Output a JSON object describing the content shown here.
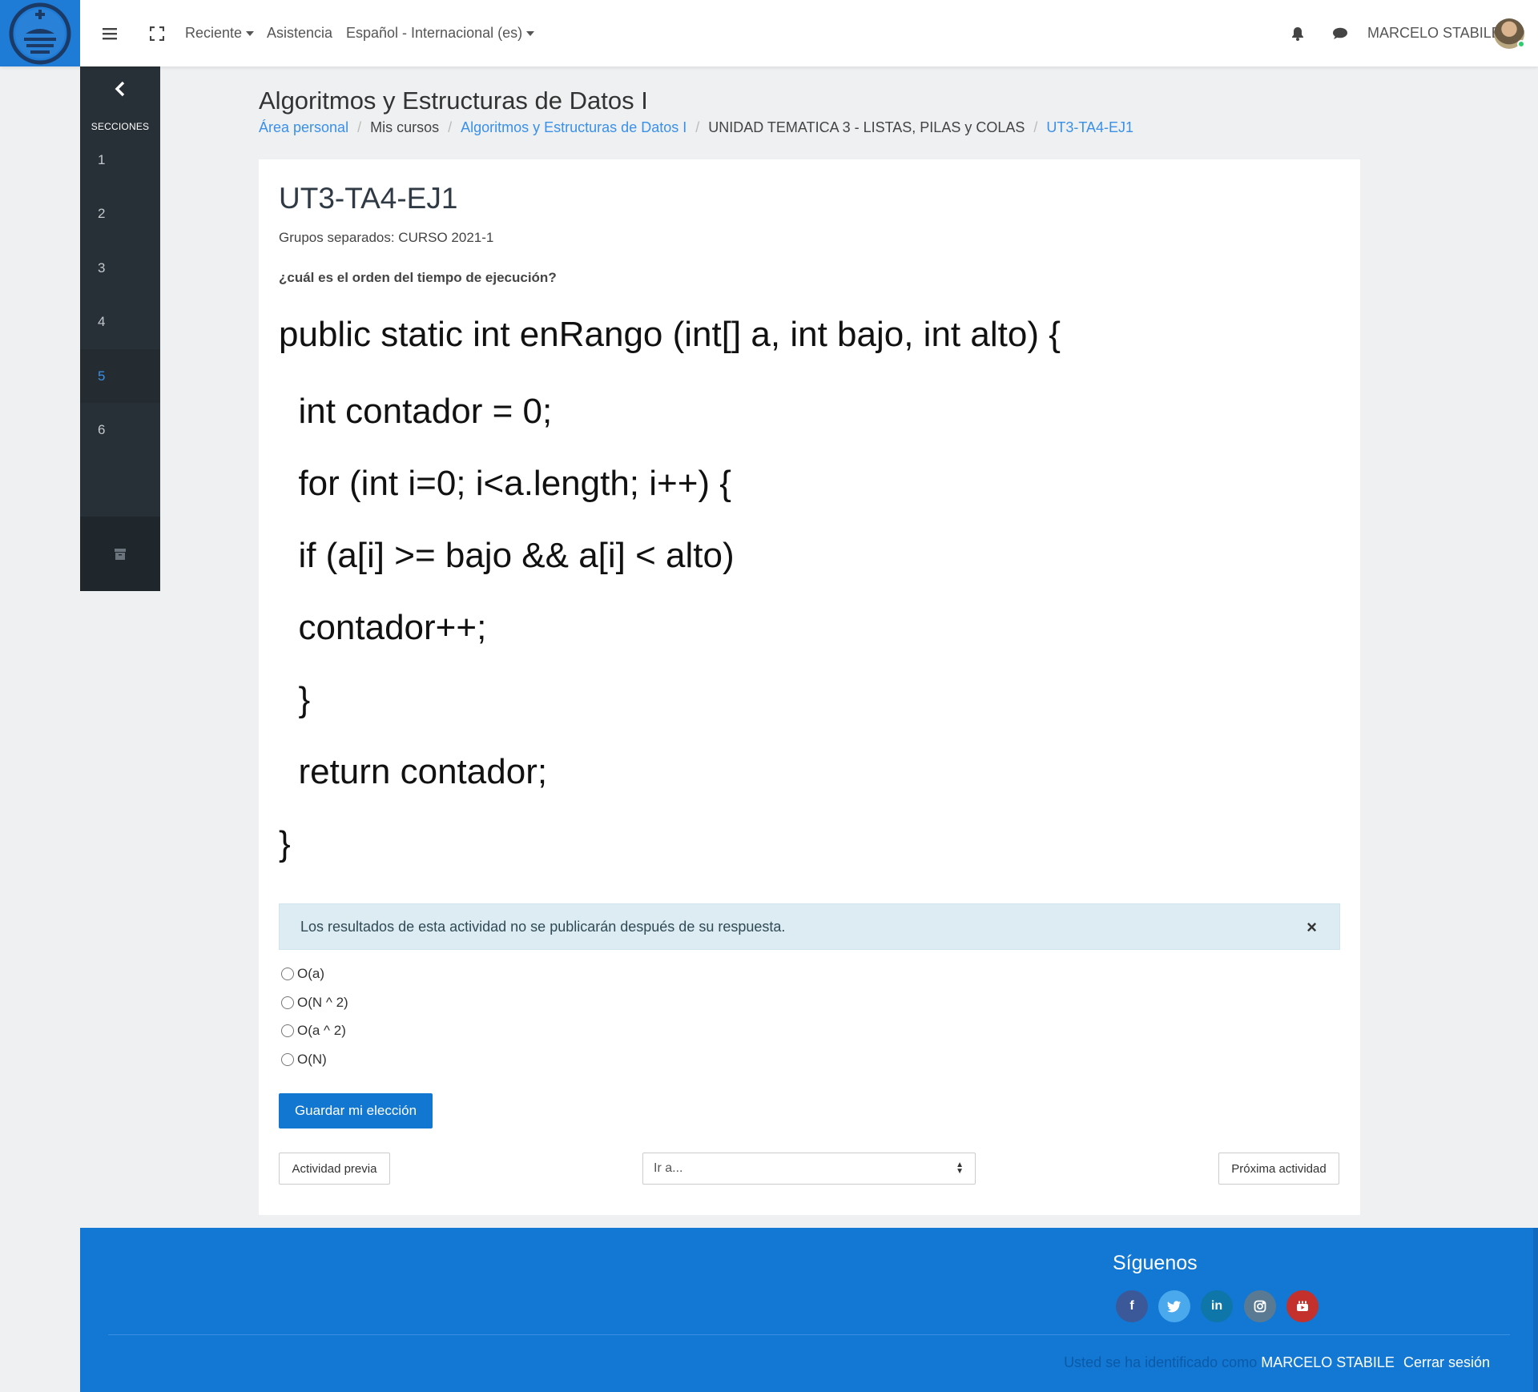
{
  "topbar": {
    "recent_label": "Reciente",
    "help_label": "Asistencia",
    "language_label": "Español - Internacional (es)",
    "user_name": "MARCELO STABILE"
  },
  "sidebar": {
    "title": "SECCIONES",
    "sections": [
      "1",
      "2",
      "3",
      "4",
      "5",
      "6"
    ],
    "active_section": "5"
  },
  "header": {
    "course_title": "Algoritmos y Estructuras de Datos I",
    "breadcrumb": [
      {
        "label": "Área personal"
      },
      {
        "label": "Mis cursos"
      },
      {
        "label": "Algoritmos y Estructuras de Datos I"
      },
      {
        "label": "UNIDAD TEMATICA 3 - LISTAS, PILAS y COLAS"
      },
      {
        "label": "UT3-TA4-EJ1"
      }
    ]
  },
  "activity": {
    "title": "UT3-TA4-EJ1",
    "groups": "Grupos separados: CURSO 2021-1",
    "question": "¿cuál es el orden del tiempo de ejecución?",
    "code_lines": [
      "public static int enRango (int[] a, int bajo, int alto) {",
      "  int contador = 0;",
      "  for (int i=0; i<a.length; i++) {",
      "  if (a[i] >= bajo && a[i] < alto)",
      "  contador++;",
      "  }",
      "  return contador;",
      "}"
    ],
    "alert": "Los resultados de esta actividad no se publicarán después de su respuesta.",
    "alert_close": "×",
    "options": [
      "O(a)",
      "O(N ^ 2)",
      "O(a ^ 2)",
      "O(N)"
    ],
    "save_button": "Guardar mi elección",
    "prev_button": "Actividad previa",
    "jump_placeholder": "Ir a...",
    "next_button": "Próxima actividad"
  },
  "footer": {
    "follow_title": "Síguenos",
    "social": [
      "facebook-icon",
      "twitter-icon",
      "linkedin-icon",
      "instagram-icon",
      "youtube-icon"
    ],
    "logged_as": "Usted se ha identificado como",
    "user_name": "MARCELO STABILE",
    "logout": "Cerrar sesión"
  },
  "colors": {
    "brand": "#1e7bd6",
    "sidebar": "#283037",
    "active_link": "#3a90e8",
    "footer": "#1278d4"
  }
}
